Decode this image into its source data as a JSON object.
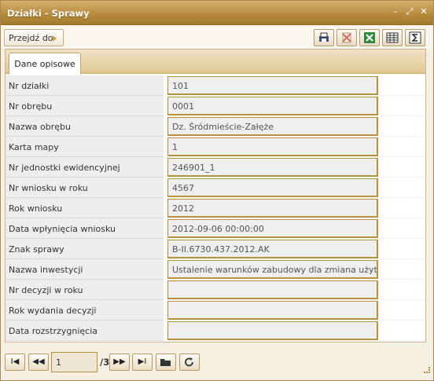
{
  "window": {
    "title": "Działki - Sprawy"
  },
  "window_controls": [
    "minimize",
    "restore",
    "close"
  ],
  "toolbar": {
    "goto_label": "Przejdź do",
    "buttons": [
      "print-icon",
      "delete-icon",
      "excel-icon",
      "table-icon",
      "sum-icon"
    ]
  },
  "tabs": [
    {
      "label": "Dane opisowe"
    }
  ],
  "fields": [
    {
      "label": "Nr działki",
      "value": "101"
    },
    {
      "label": "Nr obrębu",
      "value": "0001"
    },
    {
      "label": "Nazwa obrębu",
      "value": "Dz. Śródmieście-Załęże"
    },
    {
      "label": "Karta mapy",
      "value": "1"
    },
    {
      "label": "Nr jednostki ewidencyjnej",
      "value": "246901_1"
    },
    {
      "label": "Nr wniosku w roku",
      "value": "4567"
    },
    {
      "label": "Rok wniosku",
      "value": "2012"
    },
    {
      "label": "Data wpłynięcia wniosku",
      "value": "2012-09-06 00:00:00"
    },
    {
      "label": "Znak sprawy",
      "value": "B-II.6730.437.2012.AK"
    },
    {
      "label": "Nazwa inwestycji",
      "value": "Ustalenie warunków zabudowy dla zmiana użytkowani"
    },
    {
      "label": "Nr decyzji w roku",
      "value": ""
    },
    {
      "label": "Rok wydania decyzji",
      "value": ""
    },
    {
      "label": "Data rozstrzygnięcia",
      "value": ""
    }
  ],
  "pager": {
    "first": "I◀",
    "prev": "◀◀",
    "current_page": "1",
    "total": "/3",
    "next": "▶▶",
    "last": "▶I"
  },
  "colors": {
    "title_bar": "#b58a3c",
    "accent_border": "#b8913f"
  }
}
